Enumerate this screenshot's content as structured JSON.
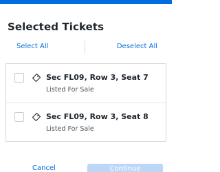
{
  "colors": {
    "accent": "#026cdf",
    "disabled_button": "#bcd6f5",
    "border": "#d0d4d9"
  },
  "title": "Selected Tickets",
  "actions": {
    "select_all": "Select All",
    "deselect_all": "Deselect All"
  },
  "tickets": [
    {
      "label": "Sec FL09, Row 3, Seat 7",
      "status": "Listed For Sale",
      "checked": false,
      "icon": "ticket-icon"
    },
    {
      "label": "Sec FL09, Row 3, Seat 8",
      "status": "Listed For Sale",
      "checked": false,
      "icon": "ticket-icon"
    }
  ],
  "footer": {
    "cancel_label": "Cancel",
    "continue_label": "Continue"
  }
}
